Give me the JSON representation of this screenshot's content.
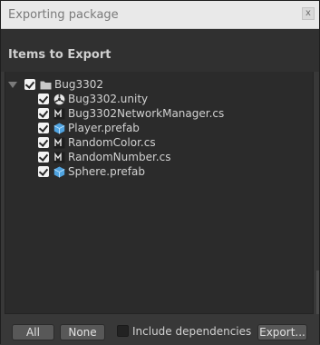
{
  "window": {
    "title": "Exporting package",
    "close_label": "x"
  },
  "header": {
    "heading": "Items to Export"
  },
  "tree": {
    "root": {
      "label": "Bug3302",
      "icon": "folder-icon",
      "checked": true,
      "expanded": true
    },
    "items": [
      {
        "label": "Bug3302.unity",
        "icon": "unity-scene-icon",
        "checked": true
      },
      {
        "label": "Bug3302NetworkManager.cs",
        "icon": "cs-script-icon",
        "checked": true
      },
      {
        "label": "Player.prefab",
        "icon": "prefab-icon",
        "checked": true
      },
      {
        "label": "RandomColor.cs",
        "icon": "cs-script-icon",
        "checked": true
      },
      {
        "label": "RandomNumber.cs",
        "icon": "cs-script-icon",
        "checked": true
      },
      {
        "label": "Sphere.prefab",
        "icon": "prefab-icon",
        "checked": true
      }
    ]
  },
  "footer": {
    "all_label": "All",
    "none_label": "None",
    "include_dependencies_label": "Include dependencies",
    "include_dependencies_checked": false,
    "export_label": "Export..."
  },
  "colors": {
    "background": "#383838",
    "panel": "#2b2b2b",
    "titlebar": "#e9e9e9",
    "prefab_blue": "#4fa3e0"
  }
}
